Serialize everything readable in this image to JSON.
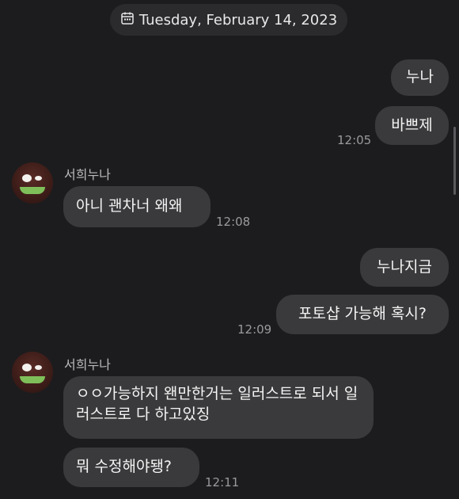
{
  "date_label": "Tuesday, February 14, 2023",
  "messages": [
    {
      "text": "누나"
    },
    {
      "text": "바쁘제"
    },
    {
      "text": "아니 괜차너 왜왜"
    },
    {
      "text": "누나지금"
    },
    {
      "text": "포토샵 가능해 혹시?"
    },
    {
      "text": "ㅇㅇ가능하지 왠만한거는 일러스트로 되서 일러스트로 다 하고있징"
    },
    {
      "text": "뭐 수정해야됑?"
    }
  ],
  "times": [
    "12:05",
    "12:08",
    "12:09",
    "12:11"
  ],
  "senders": [
    "서희누나",
    "서희누나"
  ],
  "icons": {
    "date": "calendar-icon"
  },
  "colors": {
    "background": "#1c1c1e",
    "bubble": "#3a3a3c",
    "text": "#f4f4f4",
    "time": "#9a9a9e"
  }
}
